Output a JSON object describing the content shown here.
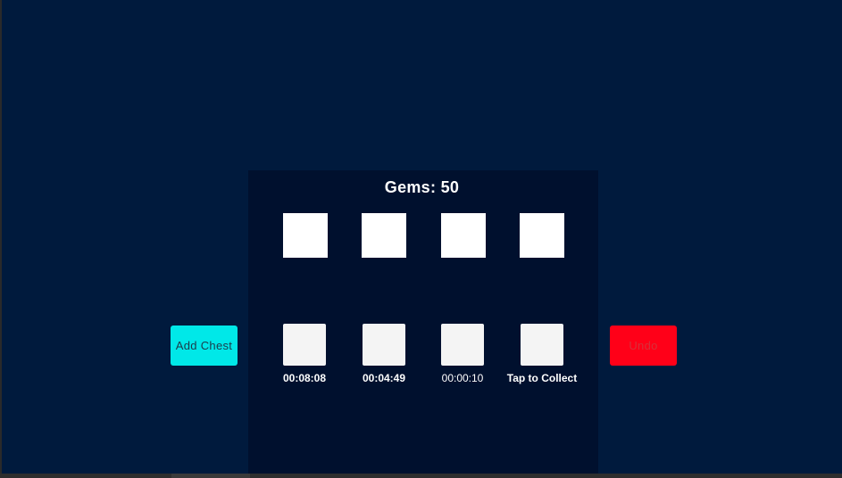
{
  "hud": {
    "gems_label": "Gems: 50"
  },
  "controls": {
    "add_chest_label": "Add Chest",
    "undo_label": "Undo"
  },
  "chest_slots": [
    {
      "timer": "00:08:08"
    },
    {
      "timer": "00:04:49"
    },
    {
      "timer": "00:00:10"
    },
    {
      "timer": "Tap to Collect"
    }
  ],
  "colors": {
    "background": "#001a3d",
    "panel": "#00102e",
    "add_button": "#00e8e8",
    "undo_button": "#ff0018"
  }
}
